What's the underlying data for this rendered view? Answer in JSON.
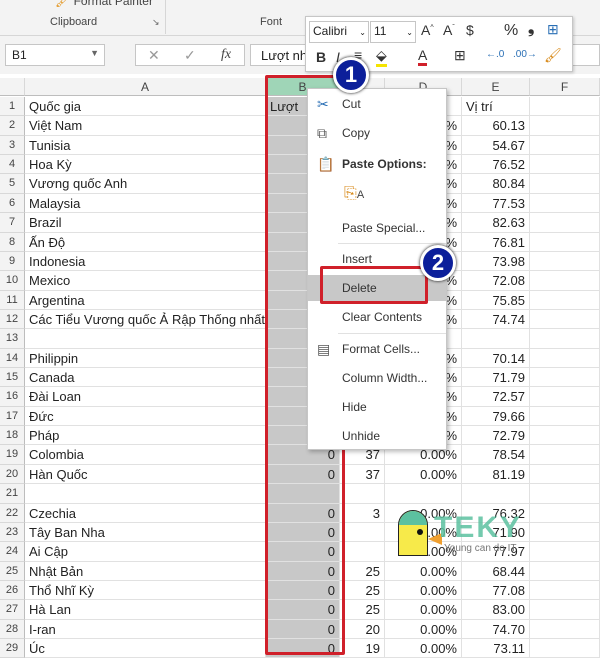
{
  "ribbon": {
    "format_painter": "Format Painter",
    "clipboard": "Clipboard",
    "font": "Font"
  },
  "formula_bar": {
    "name_box": "B1",
    "formula": "Lượt nh",
    "fx": "fx"
  },
  "columns": [
    "A",
    "B",
    "C",
    "D",
    "E",
    "F"
  ],
  "rows": [
    {
      "n": "1",
      "a": "Quốc gia",
      "b": "Lượt",
      "c": "",
      "d": "",
      "e": "Vị trí"
    },
    {
      "n": "2",
      "a": "Việt Nam",
      "b": "",
      "c": "",
      "d": "%",
      "e": "60.13"
    },
    {
      "n": "3",
      "a": "Tunisia",
      "b": "",
      "c": "",
      "d": "%",
      "e": "54.67"
    },
    {
      "n": "4",
      "a": "Hoa Kỳ",
      "b": "",
      "c": "",
      "d": "%",
      "e": "76.52"
    },
    {
      "n": "5",
      "a": "Vương quốc Anh",
      "b": "",
      "c": "",
      "d": "%",
      "e": "80.84"
    },
    {
      "n": "6",
      "a": "Malaysia",
      "b": "",
      "c": "",
      "d": "%",
      "e": "77.53"
    },
    {
      "n": "7",
      "a": "Brazil",
      "b": "",
      "c": "",
      "d": "%",
      "e": "82.63"
    },
    {
      "n": "8",
      "a": "Ấn Độ",
      "b": "",
      "c": "",
      "d": "%",
      "e": "76.81"
    },
    {
      "n": "9",
      "a": "Indonesia",
      "b": "",
      "c": "",
      "d": "",
      "e": "73.98"
    },
    {
      "n": "10",
      "a": "Mexico",
      "b": "",
      "c": "",
      "d": "%",
      "e": "72.08"
    },
    {
      "n": "11",
      "a": "Argentina",
      "b": "",
      "c": "",
      "d": "%",
      "e": "75.85"
    },
    {
      "n": "12",
      "a": "Các Tiểu Vương quốc Ả Rập Thống nhất",
      "b": "",
      "c": "",
      "d": "%",
      "e": "74.74"
    },
    {
      "n": "13",
      "a": "",
      "b": "",
      "c": "",
      "d": "",
      "e": ""
    },
    {
      "n": "14",
      "a": "Philippin",
      "b": "",
      "c": "",
      "d": "%",
      "e": "70.14"
    },
    {
      "n": "15",
      "a": "Canada",
      "b": "",
      "c": "",
      "d": "%",
      "e": "71.79"
    },
    {
      "n": "16",
      "a": "Đài Loan",
      "b": "",
      "c": "",
      "d": "%",
      "e": "72.57"
    },
    {
      "n": "17",
      "a": "Đức",
      "b": "",
      "c": "",
      "d": "%",
      "e": "79.66"
    },
    {
      "n": "18",
      "a": "Pháp",
      "b": "",
      "c": "",
      "d": "%",
      "e": "72.79"
    },
    {
      "n": "19",
      "a": "Colombia",
      "b": "0",
      "c": "37",
      "d": "0.00%",
      "e": "78.54"
    },
    {
      "n": "20",
      "a": "Hàn Quốc",
      "b": "0",
      "c": "37",
      "d": "0.00%",
      "e": "81.19"
    },
    {
      "n": "21",
      "a": "",
      "b": "",
      "c": "",
      "d": "",
      "e": ""
    },
    {
      "n": "22",
      "a": "Czechia",
      "b": "0",
      "c": "3",
      "d": "0.00%",
      "e": "76.32"
    },
    {
      "n": "23",
      "a": "Tây Ban Nha",
      "b": "0",
      "c": "",
      "d": "0.00%",
      "e": "71.90"
    },
    {
      "n": "24",
      "a": "Ai Cập",
      "b": "0",
      "c": "",
      "d": "0.00%",
      "e": "77.97"
    },
    {
      "n": "25",
      "a": "Nhật Bản",
      "b": "0",
      "c": "25",
      "d": "0.00%",
      "e": "68.44"
    },
    {
      "n": "26",
      "a": "Thổ Nhĩ Kỳ",
      "b": "0",
      "c": "25",
      "d": "0.00%",
      "e": "77.08"
    },
    {
      "n": "27",
      "a": "Hà Lan",
      "b": "0",
      "c": "25",
      "d": "0.00%",
      "e": "83.00"
    },
    {
      "n": "28",
      "a": "I-ran",
      "b": "0",
      "c": "20",
      "d": "0.00%",
      "e": "74.70"
    },
    {
      "n": "29",
      "a": "Úc",
      "b": "0",
      "c": "19",
      "d": "0.00%",
      "e": "73.11"
    }
  ],
  "mini_toolbar": {
    "font": "Calibri",
    "size": "11",
    "bold": "B",
    "italic": "I",
    "percent": "%",
    "currency": "$"
  },
  "context_menu": {
    "items": [
      "Cut",
      "Copy",
      "Paste Options:",
      "Paste Special...",
      "Insert",
      "Delete",
      "Clear Contents",
      "Format Cells...",
      "Column Width...",
      "Hide",
      "Unhide"
    ]
  },
  "badges": [
    "1",
    "2"
  ],
  "watermark": {
    "brand": "TEKY",
    "tagline": "Young can do IT"
  },
  "colors": {
    "highlight_red": "#d0202a",
    "badge_blue": "#0c1f9a",
    "selection_gray": "#c8c8c8",
    "header_green": "#9fd5b7"
  }
}
